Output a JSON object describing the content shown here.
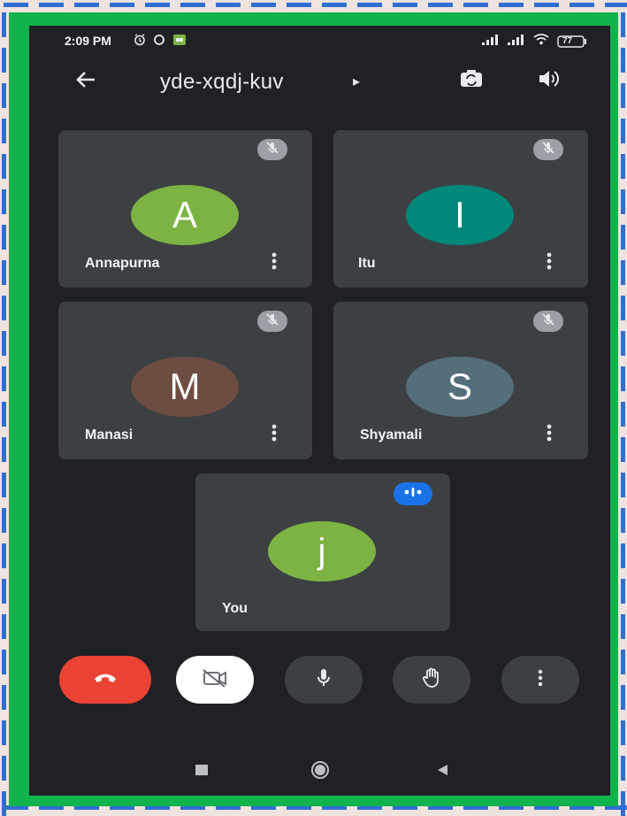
{
  "status_bar": {
    "time": "2:09 PM",
    "battery": "77",
    "icons_left": [
      "alarm-icon",
      "ring-icon",
      "message-app-icon"
    ],
    "icons_right": [
      "signal-icon",
      "signal-icon",
      "wifi-icon",
      "battery-icon"
    ]
  },
  "header": {
    "meeting_code": "yde-xqdj-kuv",
    "expand_indicator": "▸",
    "back_icon": "arrow-left-icon",
    "switch_camera_icon": "switch-camera-icon",
    "audio_icon": "speaker-icon"
  },
  "participants": [
    {
      "name": "Annapurna",
      "initial": "A",
      "color": "#7cb342",
      "muted": true
    },
    {
      "name": "Itu",
      "initial": "I",
      "color": "#00897b",
      "muted": true
    },
    {
      "name": "Manasi",
      "initial": "M",
      "color": "#6d4c41",
      "muted": true
    },
    {
      "name": "Shyamali",
      "initial": "S",
      "color": "#546e7a",
      "muted": true
    }
  ],
  "self_tile": {
    "name": "You",
    "initial": "j",
    "color": "#7cb342",
    "speaking": true
  },
  "controls": [
    {
      "id": "end-call",
      "icon": "hang-up-icon",
      "color": "#ea4335"
    },
    {
      "id": "camera",
      "icon": "camera-off-icon",
      "color": "#ffffff"
    },
    {
      "id": "microphone",
      "icon": "microphone-icon",
      "color": "#3c4043"
    },
    {
      "id": "raise-hand",
      "icon": "hand-icon",
      "color": "#3c4043"
    },
    {
      "id": "more",
      "icon": "more-vertical-icon",
      "color": "#3c4043"
    }
  ],
  "nav_bar": {
    "icons": [
      "recents-icon",
      "home-icon",
      "back-icon"
    ]
  },
  "colors": {
    "screen": "#202124",
    "tile": "#3c4043",
    "frame": "#11b34c",
    "accent": "#1a73e8"
  }
}
